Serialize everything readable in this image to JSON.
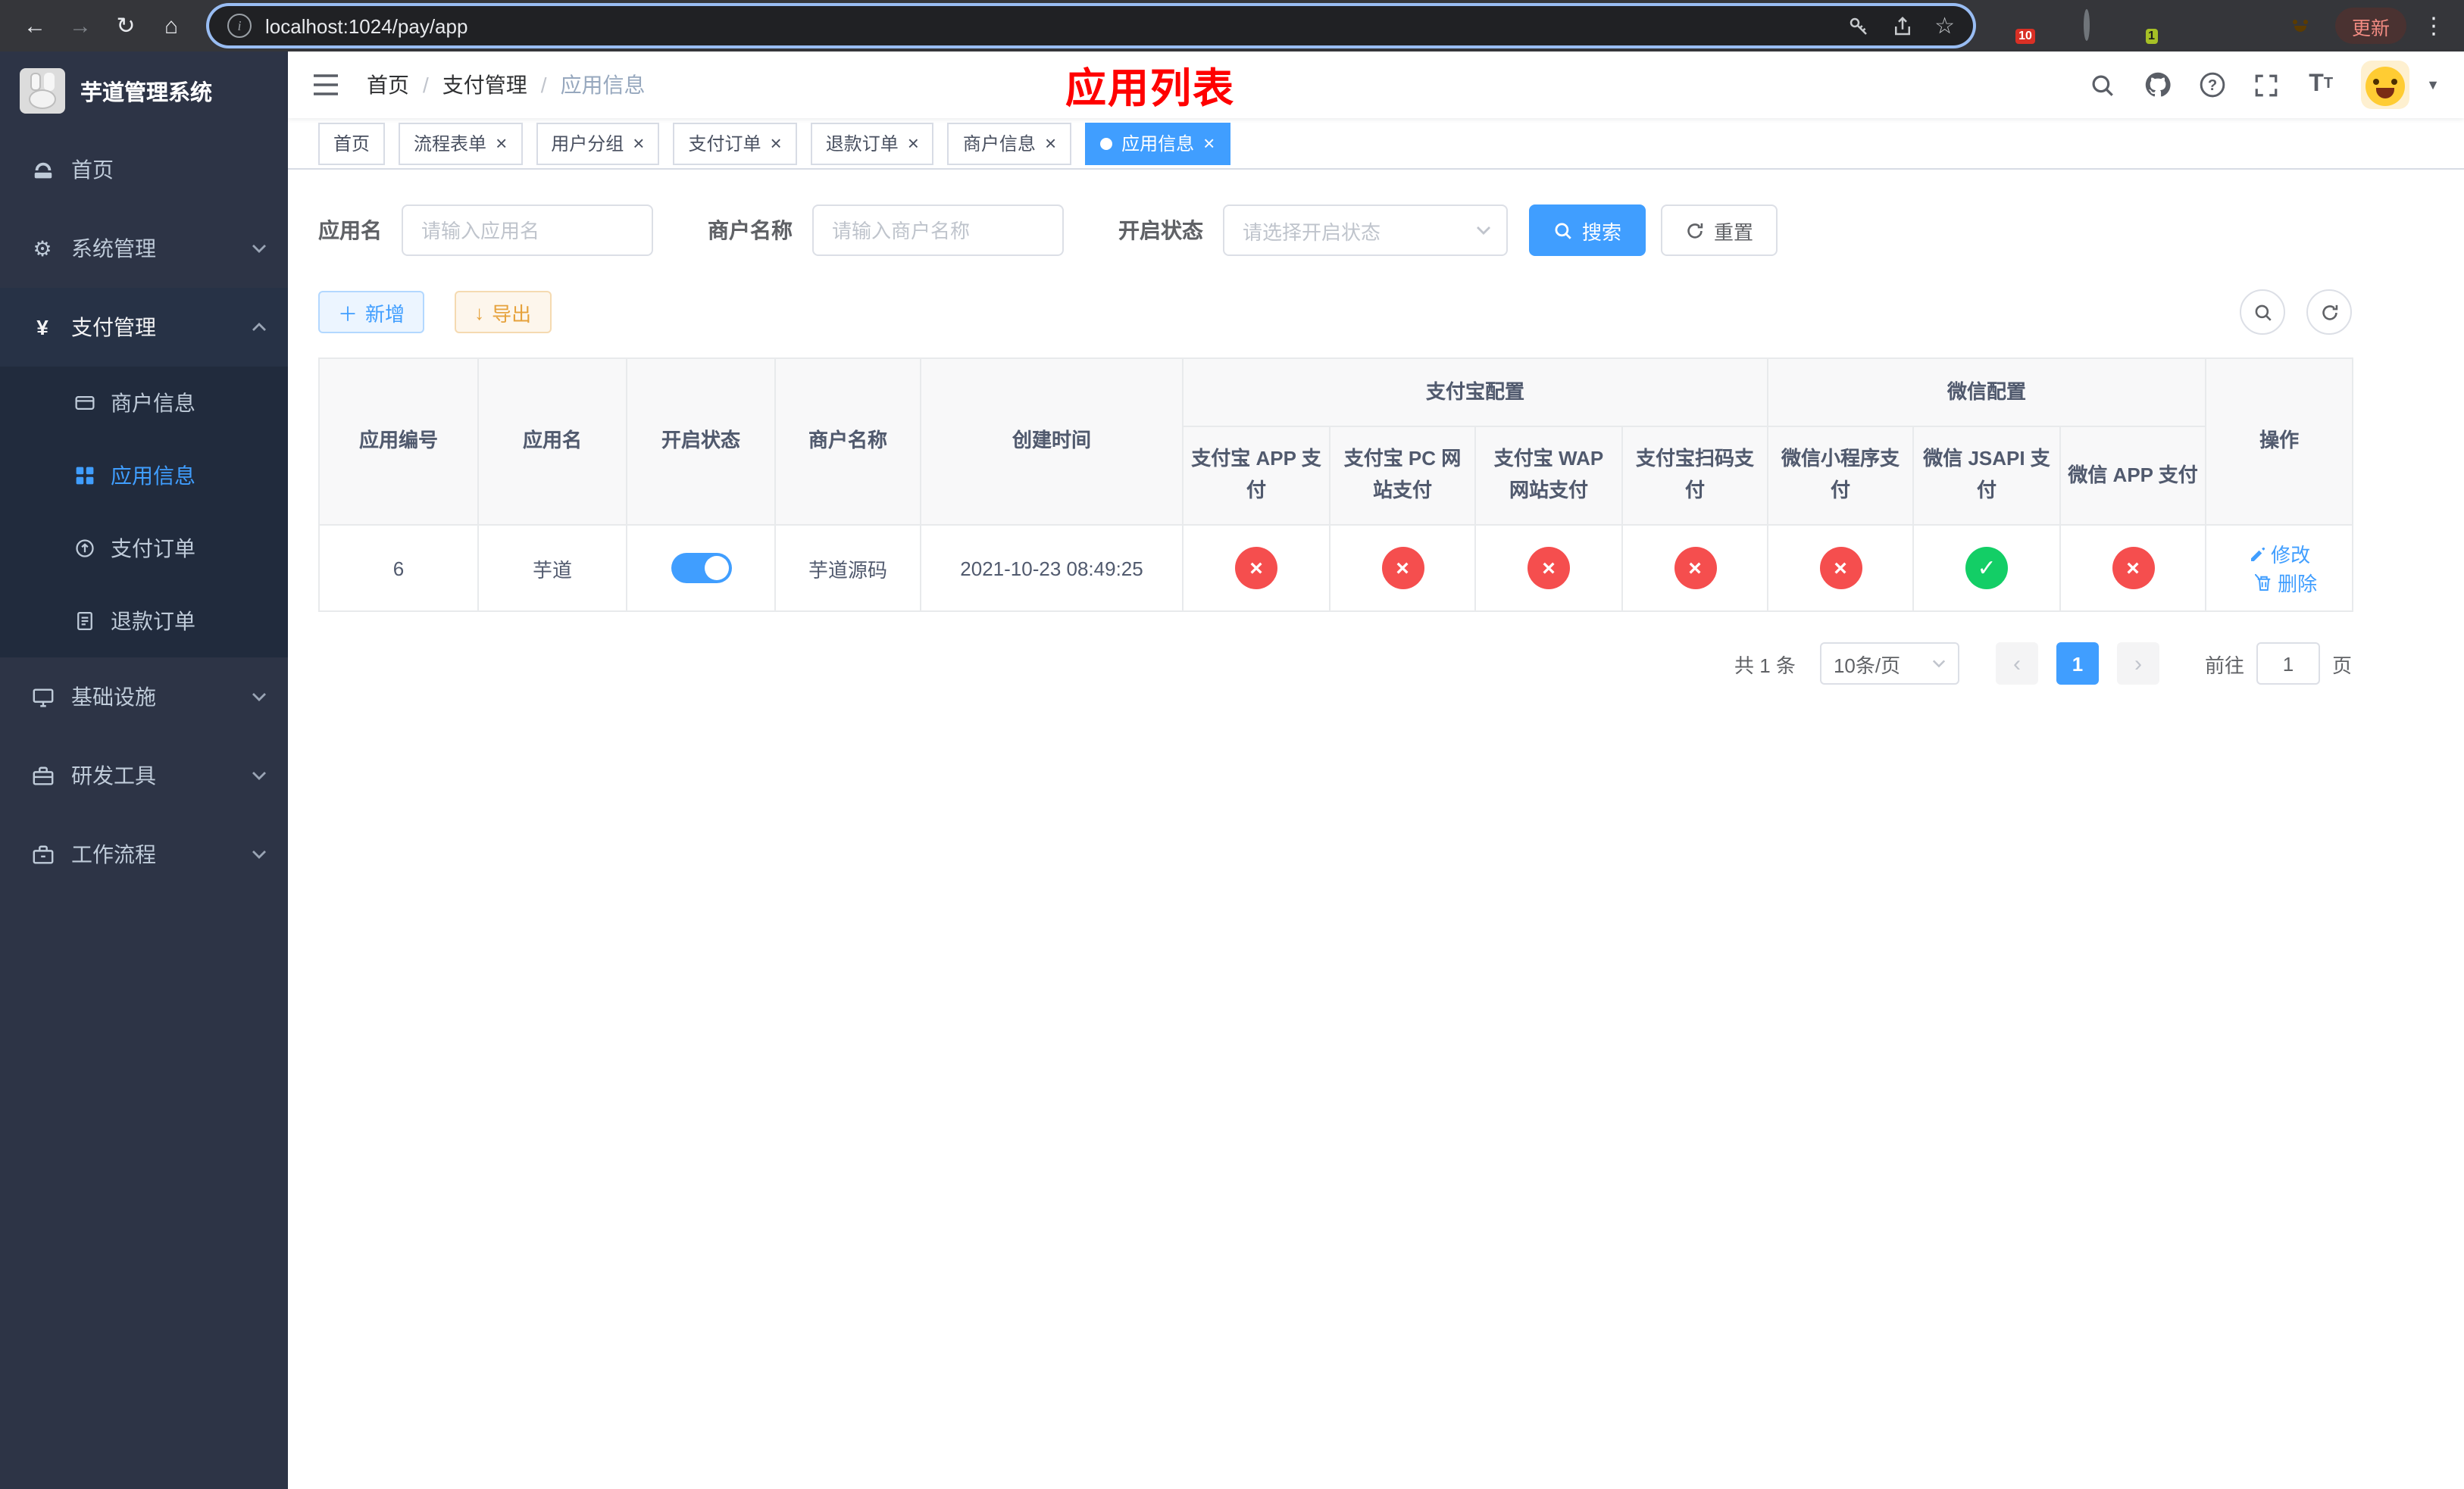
{
  "colors": {
    "primary": "#409eff",
    "danger": "#f54e4e",
    "success": "#13ce66",
    "warning": "#e6a23c",
    "title_red": "#ff0000"
  },
  "browser": {
    "url": "localhost:1024/pay/app",
    "update_label": "更新",
    "ext_badge_grid": "10",
    "ext_badge_avatar": "1"
  },
  "sidebar": {
    "title": "芋道管理系统",
    "items": [
      {
        "label": "首页"
      },
      {
        "label": "系统管理"
      },
      {
        "label": "支付管理"
      },
      {
        "label": "基础设施"
      },
      {
        "label": "研发工具"
      },
      {
        "label": "工作流程"
      }
    ],
    "payment_children": [
      {
        "label": "商户信息"
      },
      {
        "label": "应用信息"
      },
      {
        "label": "支付订单"
      },
      {
        "label": "退款订单"
      }
    ]
  },
  "header": {
    "breadcrumb": [
      "首页",
      "支付管理",
      "应用信息"
    ],
    "page_title": "应用列表"
  },
  "tabs": [
    {
      "label": "首页"
    },
    {
      "label": "流程表单"
    },
    {
      "label": "用户分组"
    },
    {
      "label": "支付订单"
    },
    {
      "label": "退款订单"
    },
    {
      "label": "商户信息"
    },
    {
      "label": "应用信息"
    }
  ],
  "filters": {
    "app_name_label": "应用名",
    "app_name_placeholder": "请输入应用名",
    "merchant_label": "商户名称",
    "merchant_placeholder": "请输入商户名称",
    "status_label": "开启状态",
    "status_placeholder": "请选择开启状态",
    "search_label": "搜索",
    "reset_label": "重置"
  },
  "toolbar": {
    "add_label": "新增",
    "export_label": "导出"
  },
  "table": {
    "col_app_id": "应用编号",
    "col_app_name": "应用名",
    "col_status": "开启状态",
    "col_merchant": "商户名称",
    "col_created": "创建时间",
    "col_actions": "操作",
    "group_alipay": "支付宝配置",
    "group_wechat": "微信配置",
    "sub_cols": [
      "支付宝 APP 支付",
      "支付宝 PC 网站支付",
      "支付宝 WAP 网站支付",
      "支付宝扫码支付",
      "微信小程序支付",
      "微信 JSAPI 支付",
      "微信 APP 支付"
    ],
    "rows": [
      {
        "id": "6",
        "name": "芋道",
        "status": "on",
        "merchant": "芋道源码",
        "created": "2021-10-23 08:49:25",
        "configs": [
          "no",
          "no",
          "no",
          "no",
          "no",
          "yes",
          "no"
        ],
        "edit_label": "修改",
        "delete_label": "删除"
      }
    ]
  },
  "pagination": {
    "total": "共 1 条",
    "page_size": "10条/页",
    "page": "1",
    "goto_prefix": "前往",
    "goto_value": "1",
    "goto_suffix": "页"
  }
}
